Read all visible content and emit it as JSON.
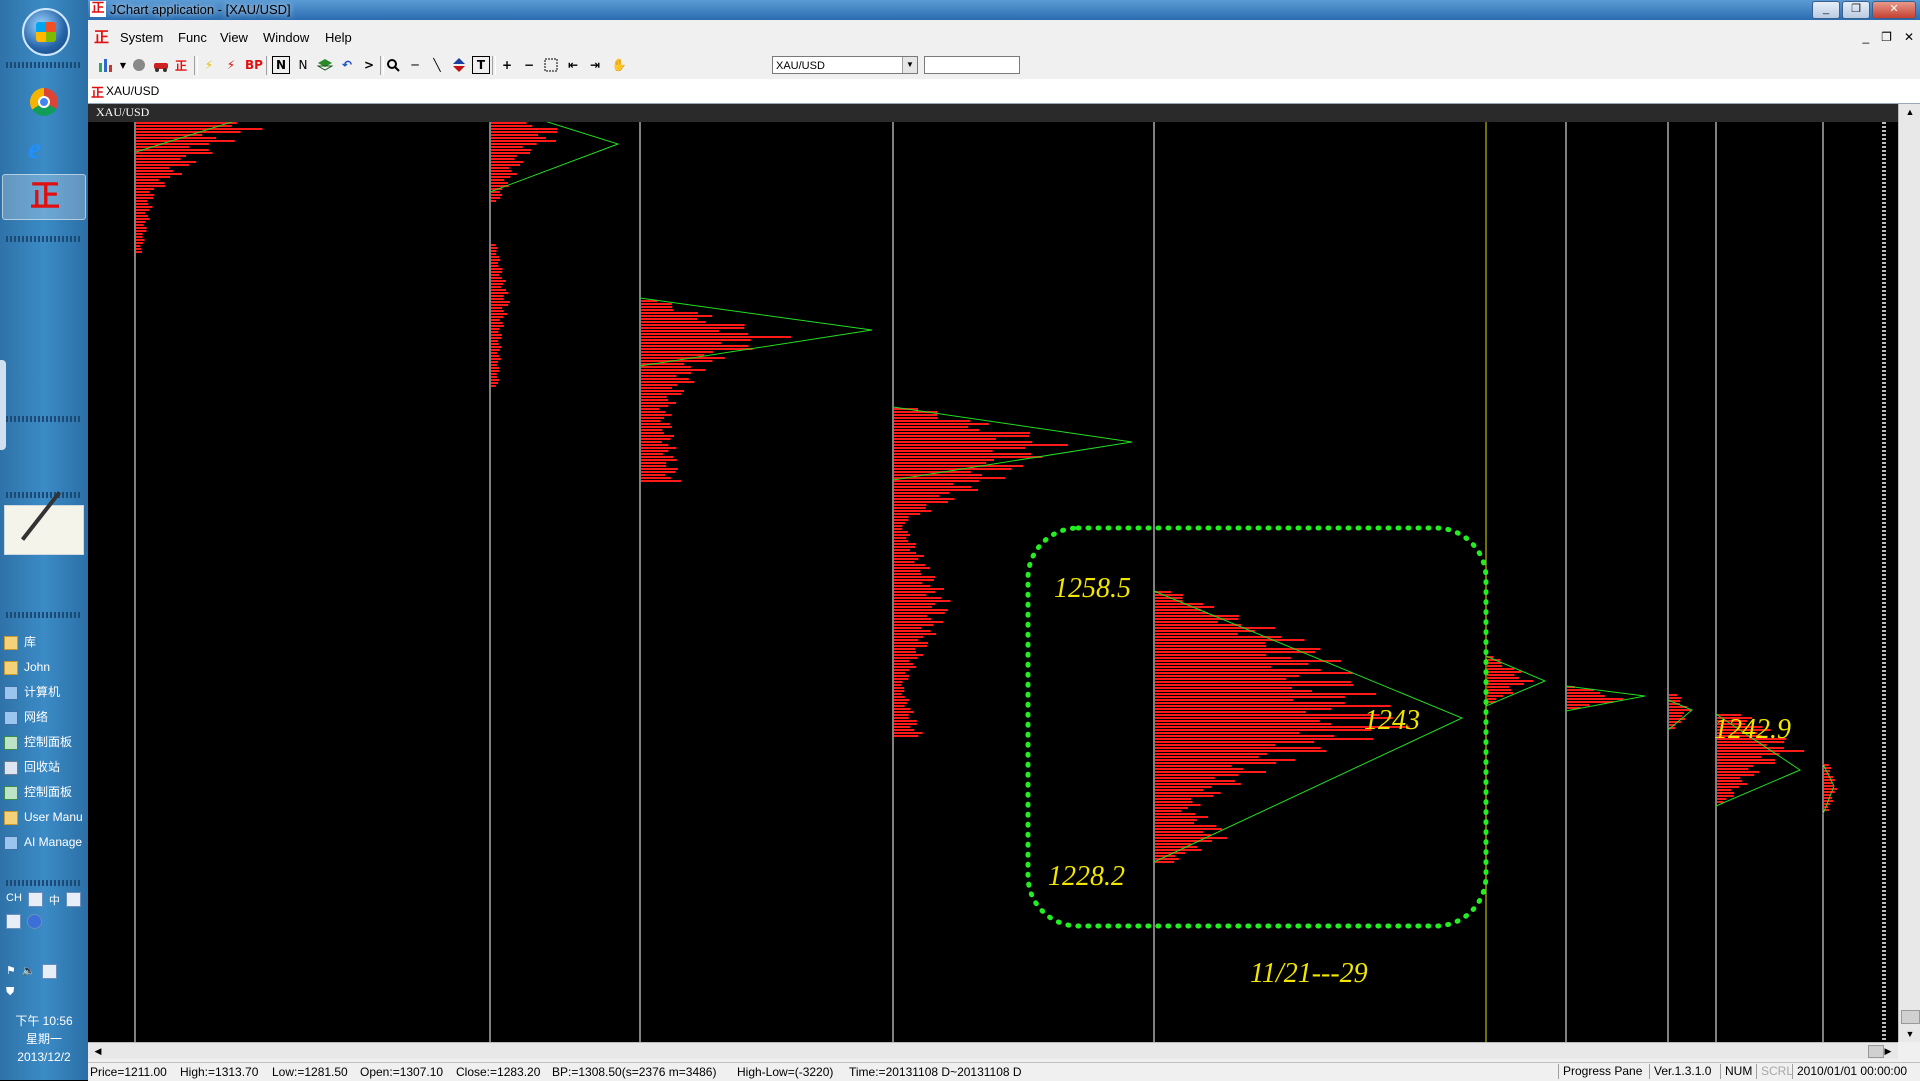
{
  "taskbar": {
    "desktop_items": [
      {
        "label": "库",
        "icon": "library-icon"
      },
      {
        "label": "John",
        "icon": "user-folder-icon"
      },
      {
        "label": "计算机",
        "icon": "computer-icon"
      },
      {
        "label": "网络",
        "icon": "network-icon"
      },
      {
        "label": "控制面板",
        "icon": "control-panel-icon"
      },
      {
        "label": "回收站",
        "icon": "recycle-bin-icon"
      },
      {
        "label": "控制面板",
        "icon": "control-panel-icon"
      },
      {
        "label": "User Manu",
        "icon": "folder-icon"
      },
      {
        "label": "AI Manage",
        "icon": "app-icon"
      }
    ],
    "lang": "CH",
    "ime": "中",
    "clock": {
      "time": "下午 10:56",
      "weekday": "星期一",
      "date": "2013/12/2"
    }
  },
  "window": {
    "title": "JChart application - [XAU/USD]",
    "controls": [
      "_",
      "❐",
      "✕"
    ]
  },
  "menu": {
    "items": [
      "System",
      "Func",
      "View",
      "Window",
      "Help"
    ],
    "mdi_controls": [
      "_",
      "❐",
      "✕"
    ]
  },
  "toolbar": {
    "bp_label": "BP",
    "n_label": "N",
    "t_label": "T",
    "symbol_value": "XAU/USD",
    "second_field_value": ""
  },
  "address": {
    "value": "XAU/USD"
  },
  "chart": {
    "symbol_header": "XAU/USD",
    "colors": {
      "profile": "#ff1a1a",
      "trend_lines": "#22dd22",
      "separators": "#ffffff",
      "highlight_separator": "#e8e000",
      "annotation": "#f2e600",
      "dotted_box": "#22ee22"
    },
    "annotations": {
      "high": "1258.5",
      "poc": "1243",
      "low": "1228.2",
      "range": "11/21---29",
      "right_poc": "1242.9"
    }
  },
  "status": {
    "price": "Price=1211.00",
    "high": "High:=1313.70",
    "low": "Low:=1281.50",
    "open": "Open:=1307.10",
    "close": "Close:=1283.20",
    "bp": "BP:=1308.50(s=2376 m=3486)",
    "high_low": "High-Low=(-3220)",
    "time": "Time:=20131108 D~20131108 D",
    "progress": "Progress Pane",
    "version": "Ver.1.3.1.0",
    "num": "NUM",
    "scrl": "SCRL",
    "datetime": "2010/01/01 00:00:00"
  }
}
